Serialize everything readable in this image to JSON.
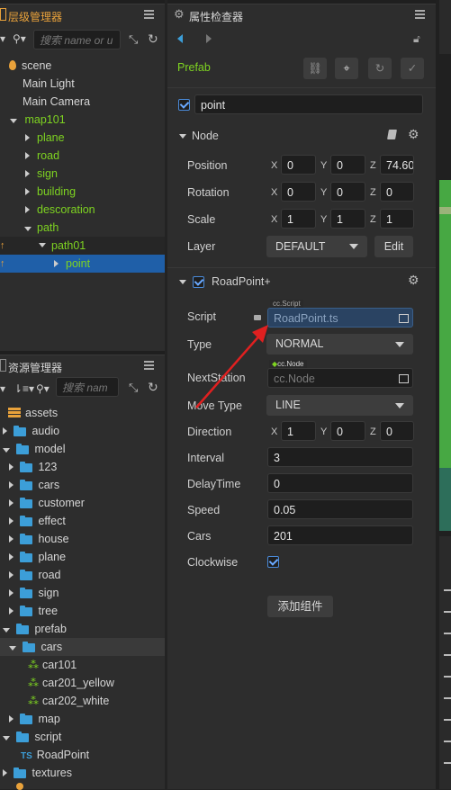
{
  "hierarchy": {
    "title": "层级管理器",
    "search_placeholder": "搜索 name or u",
    "items": [
      {
        "label": "scene"
      },
      {
        "label": "Main Light"
      },
      {
        "label": "Main Camera"
      },
      {
        "label": "map101"
      },
      {
        "label": "plane"
      },
      {
        "label": "road"
      },
      {
        "label": "sign"
      },
      {
        "label": "building"
      },
      {
        "label": "descoration"
      },
      {
        "label": "path"
      },
      {
        "label": "path01"
      },
      {
        "label": "point"
      }
    ]
  },
  "assets": {
    "title": "资源管理器",
    "search_placeholder": "搜索 nam",
    "items": [
      {
        "label": "assets"
      },
      {
        "label": "audio"
      },
      {
        "label": "model"
      },
      {
        "label": "123"
      },
      {
        "label": "cars"
      },
      {
        "label": "customer"
      },
      {
        "label": "effect"
      },
      {
        "label": "house"
      },
      {
        "label": "plane"
      },
      {
        "label": "road"
      },
      {
        "label": "sign"
      },
      {
        "label": "tree"
      },
      {
        "label": "prefab"
      },
      {
        "label": "cars"
      },
      {
        "label": "car101"
      },
      {
        "label": "car201_yellow"
      },
      {
        "label": "car202_white"
      },
      {
        "label": "map"
      },
      {
        "label": "script"
      },
      {
        "label": "RoadPoint"
      },
      {
        "label": "textures"
      }
    ],
    "ts_badge": "TS"
  },
  "inspector": {
    "title": "属性检查器",
    "prefab_label": "Prefab",
    "node_name": "point",
    "node_section": "Node",
    "position": {
      "label": "Position",
      "x": "0",
      "y": "0",
      "z": "74.60"
    },
    "rotation": {
      "label": "Rotation",
      "x": "0",
      "y": "0",
      "z": "0"
    },
    "scale": {
      "label": "Scale",
      "x": "1",
      "y": "1",
      "z": "1"
    },
    "layer": {
      "label": "Layer",
      "value": "DEFAULT",
      "edit": "Edit"
    },
    "axis": {
      "x": "X",
      "y": "Y",
      "z": "Z"
    },
    "component": {
      "name": "RoadPoint+",
      "script_label": "Script",
      "script_tag": "cc.Script",
      "script_value": "RoadPoint.ts",
      "type_label": "Type",
      "type_value": "NORMAL",
      "next_label": "NextStation",
      "next_tag": "cc.Node",
      "next_value": "cc.Node",
      "move_label": "Move Type",
      "move_value": "LINE",
      "direction": {
        "label": "Direction",
        "x": "1",
        "y": "0",
        "z": "0"
      },
      "interval_label": "Interval",
      "interval": "3",
      "delay_label": "DelayTime",
      "delay": "0",
      "speed_label": "Speed",
      "speed": "0.05",
      "cars_label": "Cars",
      "cars": "201",
      "clockwise_label": "Clockwise"
    },
    "add_component": "添加组件"
  },
  "colors": {
    "accent": "#3c9ed8",
    "prefab_green": "#7ed321",
    "annotation_red": "#e02020",
    "selection": "#1f5fa8"
  }
}
